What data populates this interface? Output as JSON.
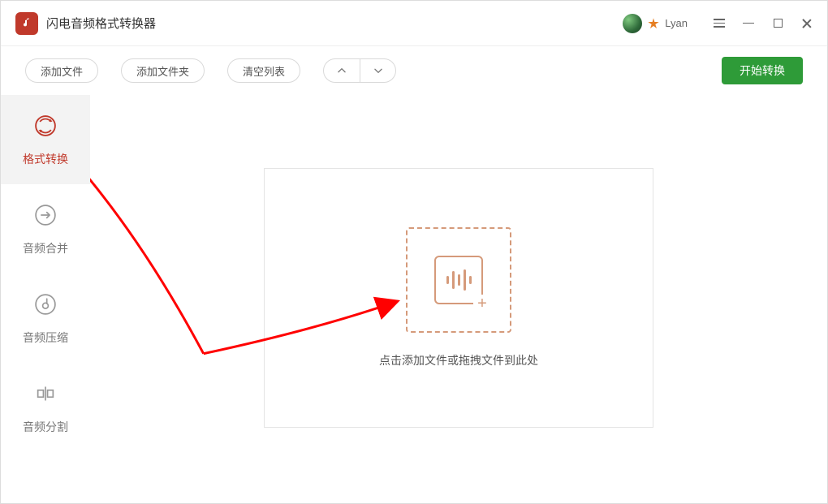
{
  "titlebar": {
    "app_name": "闪电音频格式转换器",
    "user_name": "Lyan"
  },
  "toolbar": {
    "add_file": "添加文件",
    "add_folder": "添加文件夹",
    "clear_list": "清空列表",
    "start": "开始转换"
  },
  "sidebar": {
    "items": [
      {
        "label": "格式转换",
        "icon": "convert-icon",
        "active": true
      },
      {
        "label": "音频合并",
        "icon": "merge-icon",
        "active": false
      },
      {
        "label": "音频压缩",
        "icon": "compress-icon",
        "active": false
      },
      {
        "label": "音频分割",
        "icon": "split-icon",
        "active": false
      }
    ]
  },
  "dropzone": {
    "hint": "点击添加文件或拖拽文件到此处"
  }
}
